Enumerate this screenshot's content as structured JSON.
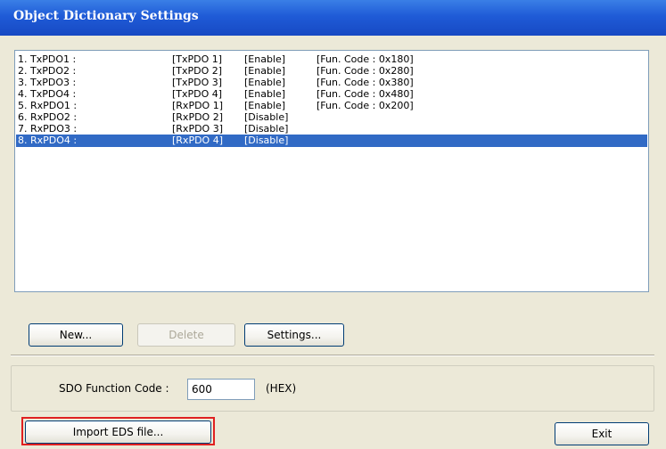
{
  "window": {
    "title": "Object Dictionary Settings",
    "title_color": "#FFFFFF",
    "titlebar_color": "#1F5BD7",
    "background_color": "#ECE9D8"
  },
  "pdo_list": {
    "selected_index": 7,
    "selection_color": "#316AC5",
    "items": [
      {
        "name": "1. TxPDO1 :",
        "pdo": "[TxPDO 1]",
        "state": "[Enable]",
        "code": "[Fun. Code : 0x180]"
      },
      {
        "name": "2. TxPDO2 :",
        "pdo": "[TxPDO 2]",
        "state": "[Enable]",
        "code": "[Fun. Code : 0x280]"
      },
      {
        "name": "3. TxPDO3 :",
        "pdo": "[TxPDO 3]",
        "state": "[Enable]",
        "code": "[Fun. Code : 0x380]"
      },
      {
        "name": "4. TxPDO4 :",
        "pdo": "[TxPDO 4]",
        "state": "[Enable]",
        "code": "[Fun. Code : 0x480]"
      },
      {
        "name": "5. RxPDO1 :",
        "pdo": "[RxPDO 1]",
        "state": "[Enable]",
        "code": "[Fun. Code : 0x200]"
      },
      {
        "name": "6. RxPDO2 :",
        "pdo": "[RxPDO 2]",
        "state": "[Disable]",
        "code": ""
      },
      {
        "name": "7. RxPDO3 :",
        "pdo": "[RxPDO 3]",
        "state": "[Disable]",
        "code": ""
      },
      {
        "name": "8. RxPDO4 :",
        "pdo": "[RxPDO 4]",
        "state": "[Disable]",
        "code": ""
      }
    ]
  },
  "buttons": {
    "new": "New...",
    "delete": "Delete",
    "settings": "Settings...",
    "import_eds": "Import EDS file...",
    "exit": "Exit"
  },
  "sdo": {
    "label": "SDO Function Code :",
    "value": "600",
    "unit": "(HEX)"
  },
  "annotation": {
    "highlight_color": "#E02020",
    "highlighted_control": "import_eds"
  }
}
